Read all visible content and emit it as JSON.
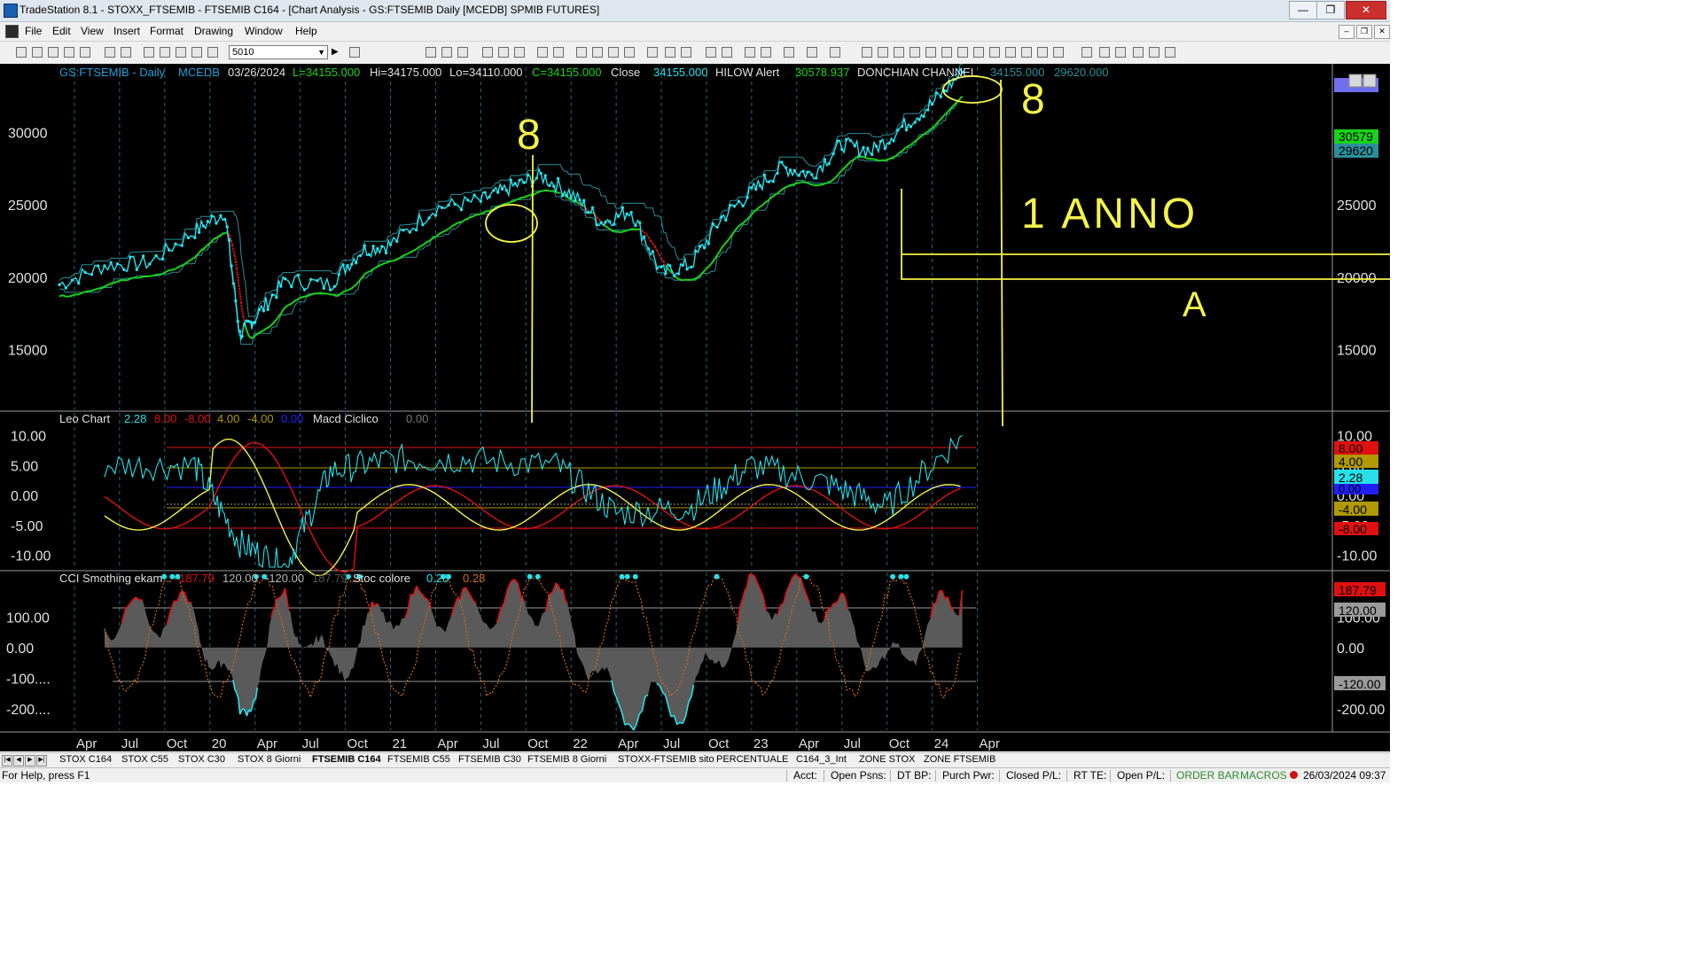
{
  "window": {
    "title": "TradeStation 8.1 - STOXX_FTSEMIB - FTSEMIB C164 - [Chart Analysis - GS:FTSEMIB  Daily  [MCEDB] SPMIB FUTURES]",
    "min_label": "—",
    "max_label": "❐",
    "close_label": "✕"
  },
  "menu": [
    "File",
    "Edit",
    "View",
    "Insert",
    "Format",
    "Drawing",
    "Window",
    "Help"
  ],
  "toolbar": {
    "symbol_value": "5010"
  },
  "chart": {
    "header": {
      "symbol": "GS:FTSEMIB - Daily",
      "feed": "MCEDB",
      "date": "03/26/2024",
      "last": "L=34155.000",
      "high": "Hi=34175.000",
      "low": "Lo=34110.000",
      "close": "C=34155.000",
      "close_label": "Close",
      "close_value": "34155.000",
      "hilow_label": "HILOW Alert",
      "hilow_value": "30578.937",
      "donchian_label": "DONCHIAN CHANNEL",
      "donchian_v1": "34155.000",
      "donchian_v2": "29620.000"
    },
    "price_axis": [
      "30000",
      "25000",
      "20000",
      "15000"
    ],
    "right_axis": [
      "25000",
      "20000",
      "15000"
    ],
    "right_badges": {
      "v1": "30579",
      "v2": "29620"
    },
    "annotations": {
      "eight_left": "8",
      "eight_right": "8",
      "one_year": "1 ANNO",
      "a": "A"
    },
    "leo": {
      "label": "Leo Chart",
      "vals": [
        "2.28",
        "8.00",
        "-8.00",
        "4.00",
        "-4.00",
        "0.00"
      ],
      "macd_label": "Macd Ciclico",
      "macd_val": "0.00",
      "axis": [
        "10.00",
        "5.00",
        "0.00",
        "-5.00",
        "-10.00"
      ],
      "right_axis": [
        "10.00",
        "5.00",
        "0.00",
        "-5.00",
        "-10.00"
      ],
      "badges": [
        "8.00",
        "4.00",
        "2.28",
        "0.00",
        "-4.00",
        "-8.00"
      ]
    },
    "cci": {
      "label": "CCI Smothing ekam",
      "vals": [
        "187.79",
        "120.00",
        "-120.00",
        "187.79"
      ],
      "stoc_label": "Stoc colore",
      "stoc_vals": [
        "0.28",
        "0.28"
      ],
      "axis": [
        "100.00",
        "0.00",
        "-100....",
        "-200...."
      ],
      "right_axis": [
        "100.00",
        "0.00",
        "-200.00"
      ],
      "badges": [
        "187.79",
        "120.00",
        "-120.00"
      ]
    },
    "time_axis": [
      "Apr",
      "Jul",
      "Oct",
      "20",
      "Apr",
      "Jul",
      "Oct",
      "21",
      "Apr",
      "Jul",
      "Oct",
      "22",
      "Apr",
      "Jul",
      "Oct",
      "23",
      "Apr",
      "Jul",
      "Oct",
      "24",
      "Apr"
    ]
  },
  "chart_data": [
    {
      "type": "line",
      "title": "GS:FTSEMIB - Daily",
      "x": [
        "2019-03",
        "2019-06",
        "2019-09",
        "2019-12",
        "2020-02",
        "2020-03",
        "2020-04",
        "2020-06",
        "2020-09",
        "2020-11",
        "2021-01",
        "2021-04",
        "2021-07",
        "2021-09",
        "2021-11",
        "2022-01",
        "2022-03",
        "2022-05",
        "2022-07",
        "2022-09",
        "2022-11",
        "2023-01",
        "2023-03",
        "2023-05",
        "2023-07",
        "2023-09",
        "2023-11",
        "2024-01",
        "2024-03"
      ],
      "series": [
        {
          "name": "Close",
          "values": [
            19500,
            20800,
            21000,
            23200,
            24500,
            16000,
            17200,
            19800,
            19500,
            21800,
            22300,
            24800,
            25300,
            26200,
            27000,
            25800,
            23800,
            24600,
            20300,
            20900,
            24100,
            25900,
            27600,
            27100,
            29200,
            28700,
            30400,
            32000,
            34155
          ]
        }
      ],
      "ylim": [
        11000,
        34500
      ]
    },
    {
      "type": "line",
      "title": "Leo Chart",
      "x": [
        "2019-06",
        "2019-12",
        "2020-03",
        "2020-06",
        "2020-09",
        "2021-01",
        "2021-06",
        "2021-12",
        "2022-04",
        "2022-09",
        "2023-01",
        "2023-06",
        "2023-10",
        "2024-03"
      ],
      "series": [
        {
          "name": "Leo Chart",
          "values": [
            5,
            5,
            -8,
            -12,
            4,
            6,
            6,
            5,
            -3,
            -2,
            5,
            2,
            -2,
            10
          ]
        }
      ],
      "ylim": [
        -12,
        12
      ]
    },
    {
      "type": "area",
      "title": "CCI Smothing ekam",
      "x": [
        "2019-06",
        "2019-12",
        "2020-03",
        "2020-06",
        "2020-09",
        "2021-01",
        "2021-06",
        "2021-12",
        "2022-04",
        "2022-09",
        "2023-01",
        "2023-06",
        "2023-10",
        "2024-03"
      ],
      "series": [
        {
          "name": "CCI Smothing ekam",
          "values": [
            100,
            110,
            -220,
            150,
            -80,
            130,
            120,
            160,
            -200,
            -170,
            170,
            160,
            -80,
            187.79
          ]
        }
      ],
      "ylim": [
        -270,
        240
      ]
    }
  ],
  "tabs": [
    "STOX C164",
    "STOX C55",
    "STOX C30",
    "STOX 8 Giorni",
    "FTSEMIB C164",
    "FTSEMIB C55",
    "FTSEMIB C30",
    "FTSEMIB 8 Giorni",
    "STOXX-FTSEMIB sito",
    "PERCENTUALE",
    "C164_3_Int",
    "ZONE STOX",
    "ZONE FTSEMIB"
  ],
  "status": {
    "help": "For Help, press F1",
    "acct": "Acct:",
    "open_psns": "Open Psns:",
    "dt_bp": "DT BP:",
    "purch_pwr": "Purch Pwr:",
    "closed_pl": "Closed P/L:",
    "rt_te": "RT TE:",
    "open_pl": "Open P/L:",
    "order_bar": "ORDER BAR",
    "macros": "MACROS",
    "datetime": "26/03/2024 09:37"
  },
  "colors": {
    "cyan": "#00e5ff",
    "price": "#27e0ea",
    "green": "#18d318",
    "red": "#e01010",
    "yellow": "#f3f34a",
    "donchian": "#2b8e9b"
  }
}
